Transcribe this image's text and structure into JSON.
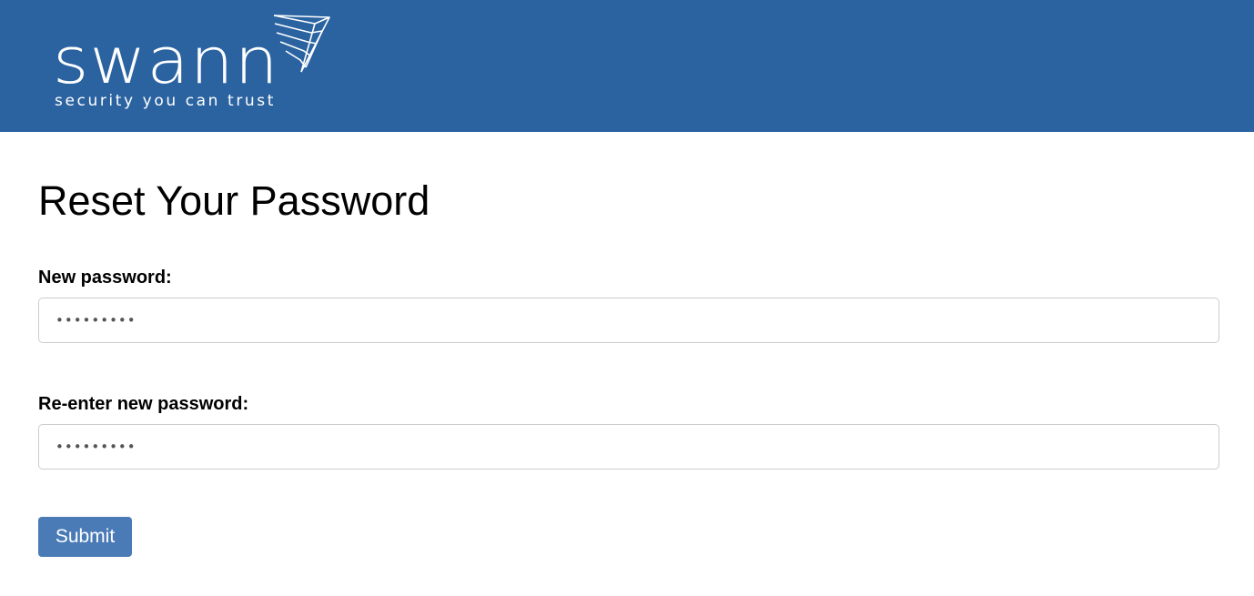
{
  "header": {
    "logo": {
      "wordmark": "swann",
      "tagline": "security you can trust",
      "icon": "swann-wing-logo-icon"
    },
    "background_color": "#2b63a1"
  },
  "form": {
    "title": "Reset Your Password",
    "new_password": {
      "label": "New password:",
      "value": "•••••••••"
    },
    "confirm_password": {
      "label": "Re-enter new password:",
      "value": "•••••••••"
    },
    "submit_label": "Submit",
    "submit_color": "#4a7bb7"
  }
}
